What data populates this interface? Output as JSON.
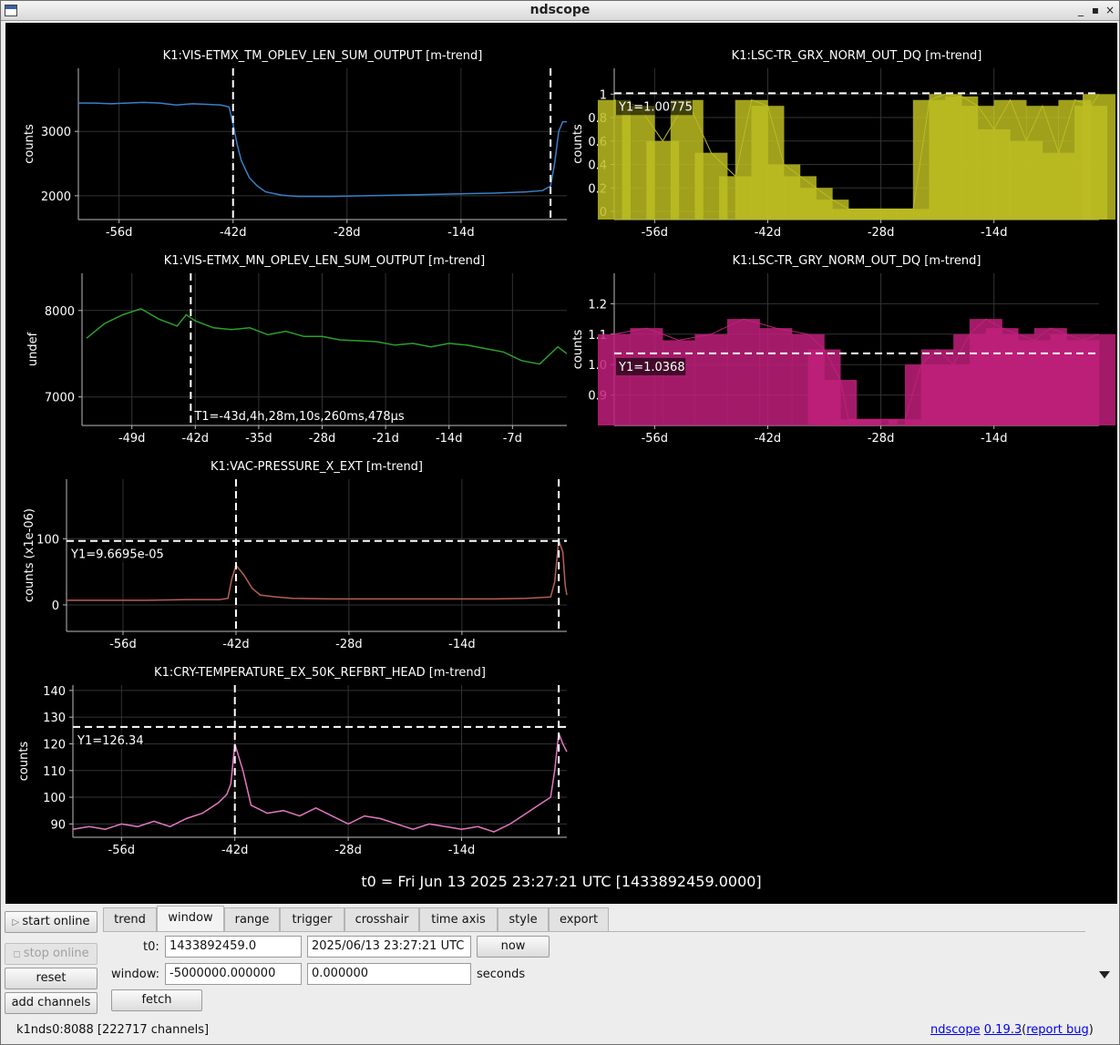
{
  "window": {
    "title": "ndscope"
  },
  "plots": [
    {
      "id": "p1",
      "title": "K1:VIS-ETMX_TM_OPLEV_LEN_SUM_OUTPUT [m-trend]",
      "ylabel": "counts",
      "yticks": [
        "3000",
        "2000"
      ],
      "xticks": [
        "-56d",
        "-42d",
        "-28d",
        "-14d"
      ],
      "color": "#3a7fc6",
      "cursor_label": ""
    },
    {
      "id": "p2",
      "title": "K1:LSC-TR_GRX_NORM_OUT_DQ [m-trend]",
      "ylabel": "counts",
      "yticks": [
        "1",
        "0.8",
        "0.6",
        "0.4",
        "0.2",
        "0"
      ],
      "xticks": [
        "-56d",
        "-42d",
        "-28d",
        "-14d"
      ],
      "color": "#bcbc22",
      "cursor_label": "Y1=1.00775"
    },
    {
      "id": "p3",
      "title": "K1:VIS-ETMX_MN_OPLEV_LEN_SUM_OUTPUT [m-trend]",
      "ylabel": "undef",
      "yticks": [
        "8000",
        "7000"
      ],
      "xticks": [
        "-49d",
        "-42d",
        "-35d",
        "-28d",
        "-21d",
        "-14d",
        "-7d"
      ],
      "color": "#2ca02c",
      "cursor_label": "T1=-43d,4h,28m,10s,260ms,478µs"
    },
    {
      "id": "p4",
      "title": "K1:LSC-TR_GRY_NORM_OUT_DQ [m-trend]",
      "ylabel": "counts",
      "yticks": [
        "1.2",
        "1.1",
        "1.0",
        "0.9"
      ],
      "xticks": [
        "-56d",
        "-42d",
        "-28d",
        "-14d"
      ],
      "color": "#c0207a",
      "cursor_label": "Y1=1.0368"
    },
    {
      "id": "p5",
      "title": "K1:VAC-PRESSURE_X_EXT [m-trend]",
      "ylabel": "counts (x1e-06)",
      "yticks": [
        "100",
        "0"
      ],
      "xticks": [
        "-56d",
        "-42d",
        "-28d",
        "-14d"
      ],
      "color": "#b86050",
      "cursor_label": "Y1=9.6695e-05"
    },
    {
      "id": "p6",
      "title": "K1:CRY-TEMPERATURE_EX_50K_REFBRT_HEAD [m-trend]",
      "ylabel": "counts",
      "yticks": [
        "140",
        "130",
        "120",
        "110",
        "100",
        "90"
      ],
      "xticks": [
        "-56d",
        "-42d",
        "-28d",
        "-14d"
      ],
      "color": "#e377c2",
      "cursor_label": "Y1=126.34"
    }
  ],
  "t0_label": "t0 = Fri Jun 13 2025 23:27:21 UTC [1433892459.0000]",
  "sidebar": {
    "start_online": "start online",
    "stop_online": "stop online",
    "reset": "reset",
    "add_channels": "add channels"
  },
  "tabs": [
    "trend",
    "window",
    "range",
    "trigger",
    "crosshair",
    "time axis",
    "style",
    "export"
  ],
  "active_tab": "window",
  "window_tab": {
    "t0_label": "t0:",
    "t0_gps": "1433892459.0",
    "t0_utc": "2025/06/13 23:27:21 UTC",
    "now_button": "now",
    "window_label": "window:",
    "window_start": "-5000000.000000",
    "window_end": "0.000000",
    "seconds_label": "seconds",
    "fetch_button": "fetch"
  },
  "status": {
    "server": "k1nds0:8088  [222717 channels]",
    "app_name": "ndscope",
    "version": "0.19.3",
    "paren_open": "(",
    "report_bug": "report bug",
    "paren_close": ")"
  },
  "chart_data": [
    {
      "type": "line",
      "title": "K1:VIS-ETMX_TM_OPLEV_LEN_SUM_OUTPUT [m-trend]",
      "ylabel": "counts",
      "xlabel": "",
      "xunit": "days",
      "xlim": [
        -61,
        -1
      ],
      "ylim": [
        1630,
        3980
      ],
      "x": [
        -61,
        -59,
        -57,
        -55,
        -53,
        -51,
        -49,
        -47,
        -45,
        -43.5,
        -42.5,
        -42,
        -41.5,
        -41,
        -40,
        -39,
        -38,
        -36,
        -34,
        -30,
        -26,
        -22,
        -18,
        -14,
        -10,
        -6,
        -4,
        -3,
        -2.5,
        -2,
        -1.5,
        -1
      ],
      "values": [
        3440,
        3440,
        3430,
        3440,
        3450,
        3440,
        3410,
        3430,
        3420,
        3410,
        3380,
        3120,
        2800,
        2550,
        2280,
        2150,
        2060,
        2010,
        1990,
        1990,
        2000,
        2010,
        2020,
        2030,
        2040,
        2060,
        2080,
        2150,
        2500,
        3000,
        3150,
        3150
      ],
      "grid": true,
      "legend": "none"
    },
    {
      "type": "line",
      "title": "K1:LSC-TR_GRX_NORM_OUT_DQ [m-trend]",
      "ylabel": "counts",
      "xlabel": "",
      "xunit": "days",
      "xlim": [
        -61,
        -1
      ],
      "ylim": [
        -0.07,
        1.22
      ],
      "x": [
        -61,
        -58,
        -55,
        -52,
        -49,
        -46,
        -44,
        -42,
        -40,
        -38,
        -36,
        -34,
        -32,
        -30,
        -28,
        -26,
        -24,
        -22,
        -20,
        -18,
        -16,
        -14,
        -12,
        -10,
        -8,
        -6,
        -4,
        -2,
        -1
      ],
      "values": [
        0.95,
        0.9,
        0.6,
        0.95,
        0.5,
        0.3,
        0.95,
        0.9,
        0.4,
        0.3,
        0.2,
        0.1,
        0.02,
        0.02,
        0.02,
        0.02,
        0.02,
        0.95,
        1.0,
        0.98,
        0.9,
        0.7,
        0.95,
        0.6,
        0.9,
        0.5,
        0.95,
        0.9,
        1.0
      ],
      "cursor_y": 1.00775,
      "grid": true,
      "legend": "none"
    },
    {
      "type": "line",
      "title": "K1:VIS-ETMX_MN_OPLEV_LEN_SUM_OUTPUT [m-trend]",
      "ylabel": "undef",
      "xlabel": "",
      "xunit": "days",
      "xlim": [
        -54.5,
        -1
      ],
      "ylim": [
        6670,
        8430
      ],
      "x": [
        -54,
        -52,
        -50,
        -48,
        -46,
        -44,
        -43,
        -42,
        -40,
        -38,
        -36,
        -34,
        -32,
        -30,
        -28,
        -26,
        -24,
        -22,
        -20,
        -18,
        -16,
        -14,
        -12,
        -10,
        -8,
        -6,
        -4,
        -2,
        -1
      ],
      "values": [
        7680,
        7850,
        7950,
        8020,
        7900,
        7820,
        7950,
        7880,
        7800,
        7780,
        7800,
        7720,
        7760,
        7700,
        7700,
        7660,
        7650,
        7640,
        7600,
        7620,
        7580,
        7620,
        7600,
        7560,
        7520,
        7420,
        7380,
        7580,
        7500
      ],
      "cursor_t": "T1=-43d,4h,28m,10s,260ms,478µs",
      "grid": true,
      "legend": "none"
    },
    {
      "type": "line",
      "title": "K1:LSC-TR_GRY_NORM_OUT_DQ [m-trend]",
      "ylabel": "counts",
      "xlabel": "",
      "xunit": "days",
      "xlim": [
        -61,
        -1
      ],
      "ylim": [
        0.8,
        1.3
      ],
      "x": [
        -61,
        -57,
        -53,
        -49,
        -45,
        -41,
        -37,
        -35,
        -33,
        -32,
        -30,
        -28,
        -25,
        -23,
        -21,
        -19,
        -17,
        -15,
        -13,
        -11,
        -9,
        -7,
        -5,
        -3,
        -1
      ],
      "values": [
        1.1,
        1.12,
        1.08,
        1.1,
        1.15,
        1.12,
        1.1,
        1.05,
        0.95,
        0.82,
        0.82,
        0.82,
        0.82,
        1.0,
        1.05,
        1.0,
        1.1,
        1.15,
        1.12,
        1.1,
        1.08,
        1.12,
        1.1,
        1.08,
        1.1
      ],
      "cursor_y": 1.0368,
      "grid": true,
      "legend": "none"
    },
    {
      "type": "line",
      "title": "K1:VAC-PRESSURE_X_EXT [m-trend]",
      "ylabel": "counts (x1e-06)",
      "xlabel": "",
      "xunit": "days",
      "xlim": [
        -63,
        -1
      ],
      "ylim": [
        -40,
        190
      ],
      "x": [
        -63,
        -58,
        -53,
        -48,
        -44,
        -43,
        -42.5,
        -42,
        -41,
        -40,
        -39,
        -37,
        -35,
        -30,
        -25,
        -20,
        -15,
        -10,
        -6,
        -3,
        -2.5,
        -2,
        -1.5,
        -1.2,
        -1
      ],
      "values": [
        7,
        7,
        7,
        8,
        8,
        10,
        40,
        60,
        45,
        25,
        15,
        12,
        10,
        9,
        9,
        9,
        9,
        9,
        10,
        12,
        35,
        98,
        80,
        30,
        15
      ],
      "cursor_y": 96.695,
      "grid": true,
      "legend": "none"
    },
    {
      "type": "line",
      "title": "K1:CRY-TEMPERATURE_EX_50K_REFBRT_HEAD [m-trend]",
      "ylabel": "counts",
      "xlabel": "",
      "xunit": "days",
      "xlim": [
        -62,
        -1
      ],
      "ylim": [
        85,
        142
      ],
      "x": [
        -62,
        -60,
        -58,
        -56,
        -54,
        -52,
        -50,
        -48,
        -46,
        -44,
        -43,
        -42.5,
        -42,
        -41,
        -40,
        -38,
        -36,
        -34,
        -32,
        -30,
        -28,
        -26,
        -24,
        -22,
        -20,
        -18,
        -16,
        -14,
        -12,
        -10,
        -8,
        -6,
        -4,
        -3,
        -2.5,
        -2,
        -1.5,
        -1
      ],
      "values": [
        88,
        89,
        88,
        90,
        89,
        91,
        89,
        92,
        94,
        98,
        101,
        105,
        120,
        110,
        97,
        94,
        95,
        93,
        96,
        93,
        90,
        93,
        92,
        90,
        88,
        90,
        89,
        88,
        89,
        87,
        90,
        94,
        98,
        100,
        110,
        124,
        120,
        117
      ],
      "cursor_y": 126.34,
      "grid": true,
      "legend": "none"
    }
  ]
}
